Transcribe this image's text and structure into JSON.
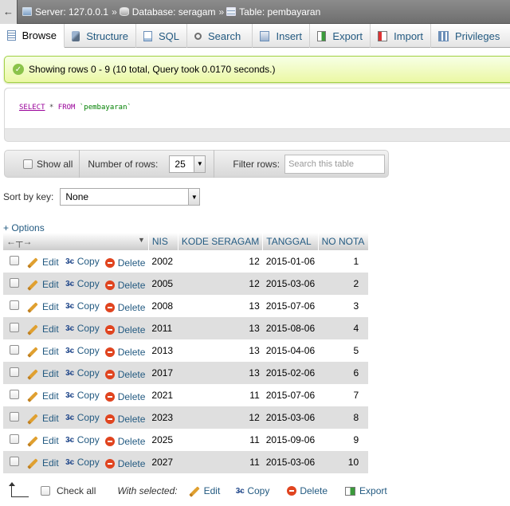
{
  "breadcrumb": {
    "back": "←",
    "server": "Server: 127.0.0.1",
    "database": "Database: seragam",
    "table": "Table: pembayaran",
    "separator": "»"
  },
  "tabs": [
    {
      "label": "Browse",
      "icon": "browse-icon",
      "active": true
    },
    {
      "label": "Structure",
      "icon": "structure-icon"
    },
    {
      "label": "SQL",
      "icon": "sql-icon"
    },
    {
      "label": "Search",
      "icon": "search-icon"
    },
    {
      "label": "Insert",
      "icon": "insert-icon"
    },
    {
      "label": "Export",
      "icon": "export-icon"
    },
    {
      "label": "Import",
      "icon": "import-icon"
    },
    {
      "label": "Privileges",
      "icon": "privileges-icon"
    }
  ],
  "message": "Showing rows 0 - 9 (10 total, Query took 0.0170 seconds.)",
  "sql": {
    "select": "SELECT",
    "star": " * ",
    "from": "FROM",
    "table": " `pembayaran`"
  },
  "nav": {
    "show_all": "Show all",
    "number_of_rows_label": "Number of rows:",
    "number_of_rows_value": "25",
    "filter_label": "Filter rows:",
    "filter_placeholder": "Search this table"
  },
  "sort": {
    "label": "Sort by key:",
    "value": "None"
  },
  "options_link": "+ Options",
  "table": {
    "columns": [
      "NIS",
      "KODE SERAGAM",
      "TANGGAL",
      "NO NOTA"
    ],
    "actions": {
      "edit": "Edit",
      "copy": "Copy",
      "delete": "Delete"
    },
    "rows": [
      {
        "nis": "2002",
        "kode": "12",
        "tanggal": "2015-01-06",
        "nota": "1"
      },
      {
        "nis": "2005",
        "kode": "12",
        "tanggal": "2015-03-06",
        "nota": "2"
      },
      {
        "nis": "2008",
        "kode": "13",
        "tanggal": "2015-07-06",
        "nota": "3"
      },
      {
        "nis": "2011",
        "kode": "13",
        "tanggal": "2015-08-06",
        "nota": "4"
      },
      {
        "nis": "2013",
        "kode": "13",
        "tanggal": "2015-04-06",
        "nota": "5"
      },
      {
        "nis": "2017",
        "kode": "13",
        "tanggal": "2015-02-06",
        "nota": "6"
      },
      {
        "nis": "2021",
        "kode": "11",
        "tanggal": "2015-07-06",
        "nota": "7"
      },
      {
        "nis": "2023",
        "kode": "12",
        "tanggal": "2015-03-06",
        "nota": "8"
      },
      {
        "nis": "2025",
        "kode": "11",
        "tanggal": "2015-09-06",
        "nota": "9"
      },
      {
        "nis": "2027",
        "kode": "11",
        "tanggal": "2015-03-06",
        "nota": "10"
      }
    ]
  },
  "bottom": {
    "check_all": "Check all",
    "with_selected": "With selected:",
    "edit": "Edit",
    "copy": "Copy",
    "delete": "Delete",
    "export": "Export"
  }
}
